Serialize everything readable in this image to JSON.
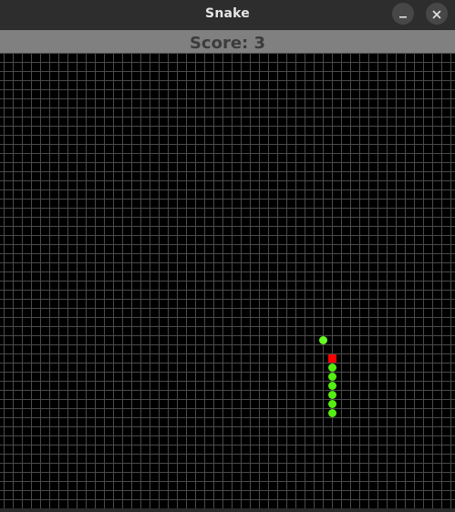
{
  "window": {
    "title": "Snake",
    "minimize_icon": "minimize-icon",
    "close_icon": "close-icon"
  },
  "score": {
    "label": "Score: 3",
    "value": 3
  },
  "game": {
    "colors": {
      "background": "#000000",
      "grid": "#4a4a4a",
      "snake_head": "#ff0000",
      "snake_body": "#55ee11",
      "food": "#66ff22",
      "score_bar": "#808080"
    }
  }
}
